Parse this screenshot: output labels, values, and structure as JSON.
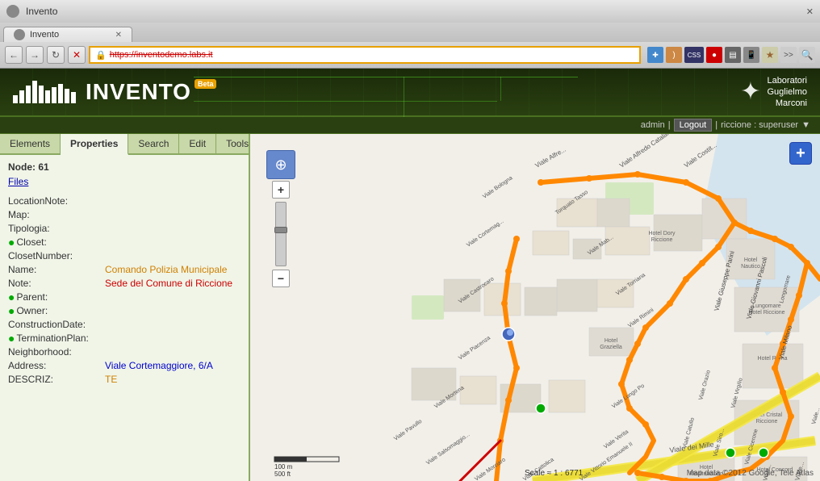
{
  "browser": {
    "title": "Invento",
    "tab_label": "Invento",
    "url": "https://inventodemo.labs.it",
    "nav_buttons": [
      "←",
      "→",
      "↻",
      "✕"
    ]
  },
  "header": {
    "logo_text": "NVENTO",
    "beta_label": "Beta",
    "company_name": "Laboratori\nGuglielmo\nMarconi",
    "user_label": "admin",
    "logout_label": "Logout",
    "user_info": "riccione : superuser"
  },
  "tabs": {
    "items": [
      "Elements",
      "Properties",
      "Search",
      "Edit",
      "Tools"
    ],
    "active": "Properties"
  },
  "properties": {
    "node_label": "Node: 61",
    "files_label": "Files",
    "fields": [
      {
        "label": "LocationNote:",
        "value": "",
        "style": "normal"
      },
      {
        "label": "Map:",
        "value": "",
        "style": "normal"
      },
      {
        "label": "Tipologia:",
        "value": "",
        "style": "normal"
      },
      {
        "label": "Closet:",
        "value": "",
        "style": "dot-green",
        "dot": true
      },
      {
        "label": "ClosetNumber:",
        "value": "",
        "style": "normal"
      },
      {
        "label": "Name:",
        "value": "Comando Polizia Municipale",
        "style": "orange"
      },
      {
        "label": "Note:",
        "value": "Sede del Comune di Riccione",
        "style": "red"
      },
      {
        "label": "Parent:",
        "value": "",
        "style": "dot-green",
        "dot": true
      },
      {
        "label": "Owner:",
        "value": "",
        "style": "dot-green",
        "dot": true
      },
      {
        "label": "ConstructionDate:",
        "value": "",
        "style": "normal"
      },
      {
        "label": "TerminationPlan:",
        "value": "",
        "style": "dot-green",
        "dot": true
      },
      {
        "label": "Neighborhood:",
        "value": "",
        "style": "normal"
      },
      {
        "label": "Address:",
        "value": "Viale Cortemaggiore, 6/A",
        "style": "blue"
      },
      {
        "label": "DESCRIZ:",
        "value": "TE",
        "style": "orange"
      }
    ]
  },
  "map": {
    "scale_labels": [
      "100 m",
      "500 ft"
    ],
    "attribution": "Map data ©2012 Google, Tele Atlas",
    "scale_text": "Scale ≈ 1 : 6771",
    "add_button": "+"
  }
}
